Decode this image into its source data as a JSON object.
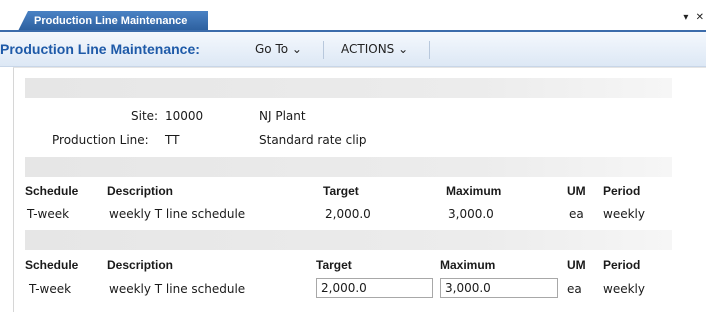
{
  "tab": {
    "label": "Production Line Maintenance",
    "controls": "▾ ✕"
  },
  "menubar": {
    "title": "Production Line Maintenance:",
    "goto_label": "Go To ⌄",
    "actions_label": "ACTIONS ⌄"
  },
  "header": {
    "site_label": "Site:",
    "site_value": "10000",
    "site_desc": "NJ Plant",
    "line_label": "Production Line:",
    "line_value": "TT",
    "line_desc": "Standard rate clip"
  },
  "grid1": {
    "columns": [
      "Schedule",
      "Description",
      "Target",
      "Maximum",
      "UM",
      "Period"
    ],
    "rows": [
      [
        "T-week",
        "weekly T line schedule",
        "2,000.0",
        "3,000.0",
        "ea",
        "weekly"
      ]
    ]
  },
  "grid2": {
    "columns": [
      "Schedule",
      "Description",
      "Target",
      "Maximum",
      "UM",
      "Period"
    ],
    "rows": [
      [
        "T-week",
        "weekly T line schedule",
        "2,000.0",
        "3,000.0",
        "ea",
        "weekly"
      ]
    ]
  },
  "colors": {
    "tab_blue": "#2c5f9e",
    "title_blue": "#1e5aa8"
  }
}
